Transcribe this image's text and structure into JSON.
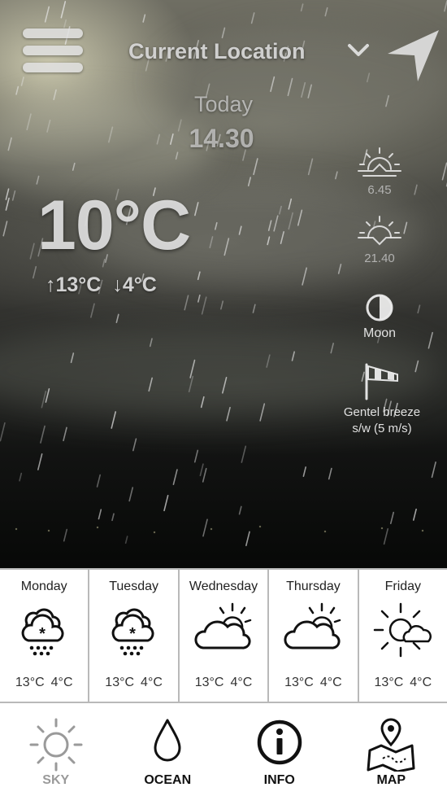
{
  "header": {
    "location": "Current Location"
  },
  "now": {
    "day_label": "Today",
    "time": "14.30",
    "temperature": "10°C",
    "high": "↑13°C",
    "low": "↓4°C"
  },
  "side_info": {
    "sunrise": "6.45",
    "sunset": "21.40",
    "moon": "Moon",
    "wind_line1": "Gentel breeze",
    "wind_line2": "s/w (5 m/s)"
  },
  "forecast": [
    {
      "day": "Monday",
      "icon": "snow-cloud-icon",
      "high": "13°C",
      "low": "4°C"
    },
    {
      "day": "Tuesday",
      "icon": "snow-cloud-icon",
      "high": "13°C",
      "low": "4°C"
    },
    {
      "day": "Wednesday",
      "icon": "partly-cloudy-icon",
      "high": "13°C",
      "low": "4°C"
    },
    {
      "day": "Thursday",
      "icon": "partly-cloudy-icon",
      "high": "13°C",
      "low": "4°C"
    },
    {
      "day": "Friday",
      "icon": "sun-moon-cloud-icon",
      "high": "13°C",
      "low": "4°C"
    }
  ],
  "tabs": [
    {
      "label": "SKY",
      "icon": "sun-icon",
      "active": false
    },
    {
      "label": "OCEAN",
      "icon": "water-drop-icon",
      "active": true
    },
    {
      "label": "INFO",
      "icon": "info-icon",
      "active": true
    },
    {
      "label": "MAP",
      "icon": "map-pin-icon",
      "active": true
    }
  ],
  "colors": {
    "text_light": "#e1e1e1",
    "divider": "#b9b9b9",
    "tab_inactive": "#9a9a9a"
  }
}
